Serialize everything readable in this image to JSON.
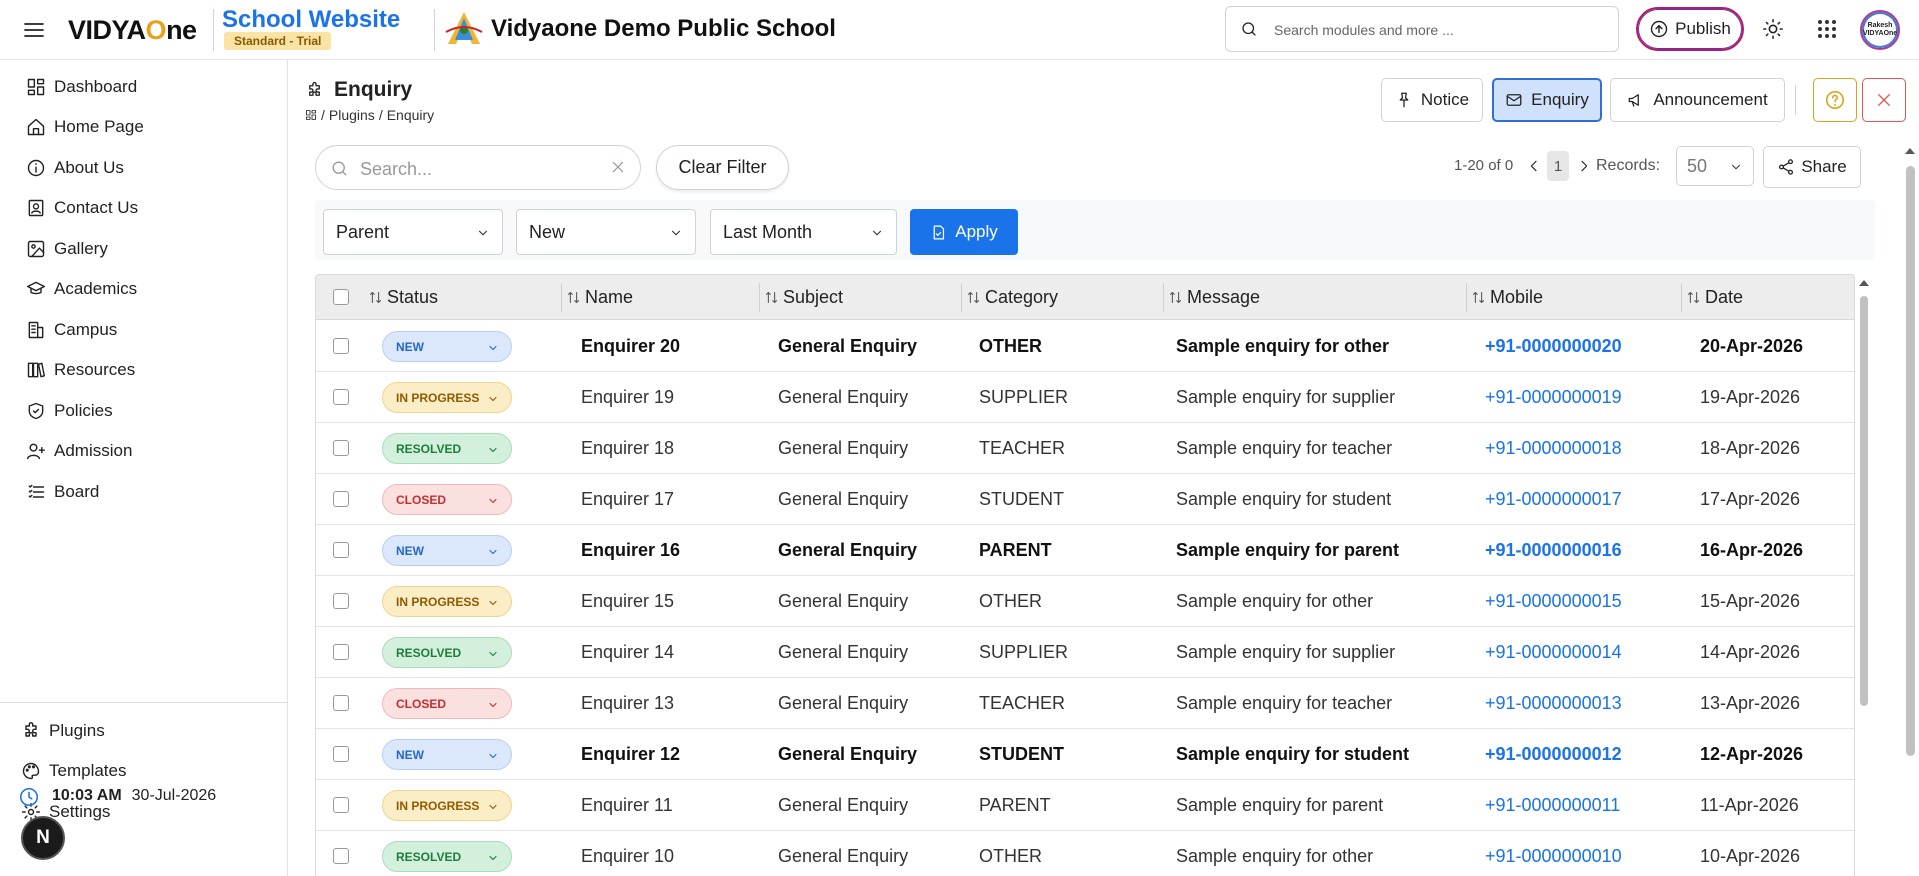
{
  "header": {
    "brand_pre": "VIDYA",
    "brand_mid": "O",
    "brand_post": "ne",
    "site_title": "School Website",
    "plan_badge": "Standard - Trial",
    "school_name": "Vidyaone Demo Public School",
    "search_placeholder": "Search modules and more ...",
    "publish_label": "Publish",
    "avatar_text": "Rakesh VIDYAOne"
  },
  "sidebar": {
    "items": [
      {
        "label": "Dashboard",
        "icon": "dashboard-icon"
      },
      {
        "label": "Home Page",
        "icon": "home-icon"
      },
      {
        "label": "About Us",
        "icon": "info-icon"
      },
      {
        "label": "Contact Us",
        "icon": "contact-icon"
      },
      {
        "label": "Gallery",
        "icon": "gallery-icon"
      },
      {
        "label": "Academics",
        "icon": "graduation-cap-icon"
      },
      {
        "label": "Campus",
        "icon": "building-icon"
      },
      {
        "label": "Resources",
        "icon": "books-icon"
      },
      {
        "label": "Policies",
        "icon": "shield-icon"
      },
      {
        "label": "Admission",
        "icon": "user-plus-icon"
      },
      {
        "label": "Board",
        "icon": "list-icon"
      }
    ],
    "bottom_items": [
      {
        "label": "Plugins",
        "icon": "puzzle-icon"
      },
      {
        "label": "Templates",
        "icon": "palette-icon"
      },
      {
        "label": "Settings",
        "icon": "gear-icon"
      }
    ],
    "time": "10:03 AM",
    "date": "30-Jul-2026",
    "bubble": "N"
  },
  "page": {
    "title": "Enquiry",
    "breadcrumb": [
      "Plugins",
      "Enquiry"
    ]
  },
  "toolbar": {
    "notice": "Notice",
    "enquiry": "Enquiry",
    "announcement": "Announcement"
  },
  "filters": {
    "search_placeholder": "Search...",
    "clear_label": "Clear Filter",
    "pager_text": "1-20 of 0",
    "current_page": "1",
    "records_label": "Records:",
    "records_value": "50",
    "share_label": "Share",
    "type_value": "Parent",
    "status_value": "New",
    "period_value": "Last Month",
    "apply_label": "Apply"
  },
  "table": {
    "columns": [
      "Status",
      "Name",
      "Subject",
      "Category",
      "Message",
      "Mobile",
      "Date"
    ],
    "rows": [
      {
        "status": "NEW",
        "name": "Enquirer 20",
        "subject": "General Enquiry",
        "category": "OTHER",
        "message": "Sample enquiry for other",
        "mobile": "+91-0000000020",
        "date": "20-Apr-2026",
        "bold": true
      },
      {
        "status": "IN PROGRESS",
        "name": "Enquirer 19",
        "subject": "General Enquiry",
        "category": "SUPPLIER",
        "message": "Sample enquiry for supplier",
        "mobile": "+91-0000000019",
        "date": "19-Apr-2026",
        "bold": false
      },
      {
        "status": "RESOLVED",
        "name": "Enquirer 18",
        "subject": "General Enquiry",
        "category": "TEACHER",
        "message": "Sample enquiry for teacher",
        "mobile": "+91-0000000018",
        "date": "18-Apr-2026",
        "bold": false
      },
      {
        "status": "CLOSED",
        "name": "Enquirer 17",
        "subject": "General Enquiry",
        "category": "STUDENT",
        "message": "Sample enquiry for student",
        "mobile": "+91-0000000017",
        "date": "17-Apr-2026",
        "bold": false
      },
      {
        "status": "NEW",
        "name": "Enquirer 16",
        "subject": "General Enquiry",
        "category": "PARENT",
        "message": "Sample enquiry for parent",
        "mobile": "+91-0000000016",
        "date": "16-Apr-2026",
        "bold": true
      },
      {
        "status": "IN PROGRESS",
        "name": "Enquirer 15",
        "subject": "General Enquiry",
        "category": "OTHER",
        "message": "Sample enquiry for other",
        "mobile": "+91-0000000015",
        "date": "15-Apr-2026",
        "bold": false
      },
      {
        "status": "RESOLVED",
        "name": "Enquirer 14",
        "subject": "General Enquiry",
        "category": "SUPPLIER",
        "message": "Sample enquiry for supplier",
        "mobile": "+91-0000000014",
        "date": "14-Apr-2026",
        "bold": false
      },
      {
        "status": "CLOSED",
        "name": "Enquirer 13",
        "subject": "General Enquiry",
        "category": "TEACHER",
        "message": "Sample enquiry for teacher",
        "mobile": "+91-0000000013",
        "date": "13-Apr-2026",
        "bold": false
      },
      {
        "status": "NEW",
        "name": "Enquirer 12",
        "subject": "General Enquiry",
        "category": "STUDENT",
        "message": "Sample enquiry for student",
        "mobile": "+91-0000000012",
        "date": "12-Apr-2026",
        "bold": true
      },
      {
        "status": "IN PROGRESS",
        "name": "Enquirer 11",
        "subject": "General Enquiry",
        "category": "PARENT",
        "message": "Sample enquiry for parent",
        "mobile": "+91-0000000011",
        "date": "11-Apr-2026",
        "bold": false
      },
      {
        "status": "RESOLVED",
        "name": "Enquirer 10",
        "subject": "General Enquiry",
        "category": "OTHER",
        "message": "Sample enquiry for other",
        "mobile": "+91-0000000010",
        "date": "10-Apr-2026",
        "bold": false
      }
    ]
  },
  "colors": {
    "accent": "#1a73e8",
    "new": "#2566c8",
    "in_progress": "#8f5a00",
    "resolved": "#1e7d3b",
    "closed": "#c43030"
  }
}
